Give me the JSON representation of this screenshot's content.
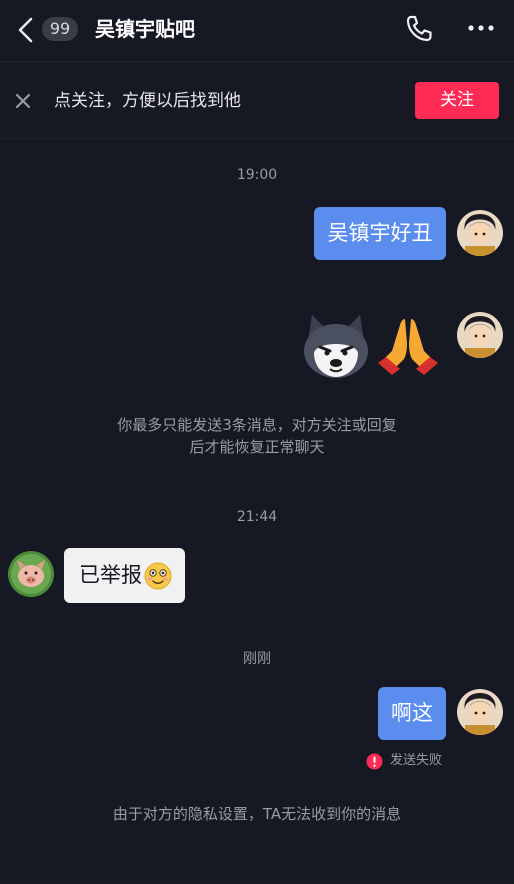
{
  "header": {
    "unread_count": "99",
    "title": "吴镇宇贴吧"
  },
  "follow_bar": {
    "prompt": "点关注，方便以后找到他",
    "button_label": "关注"
  },
  "messages": {
    "time1": "19:00",
    "msg1": "吴镇宇好丑",
    "notice1_line1": "你最多只能发送3条消息，对方关注或回复",
    "notice1_line2": "后才能恢复正常聊天",
    "time2": "21:44",
    "msg_in": "已举报",
    "time3": "刚刚",
    "msg3": "啊这",
    "fail_status": "发送失败",
    "notice2": "由于对方的隐私设置，TA无法收到你的消息"
  },
  "colors": {
    "background": "#161823",
    "accent": "#fe2c55",
    "outgoing_bubble": "#5a8dee",
    "incoming_bubble": "#f1f1f1"
  }
}
